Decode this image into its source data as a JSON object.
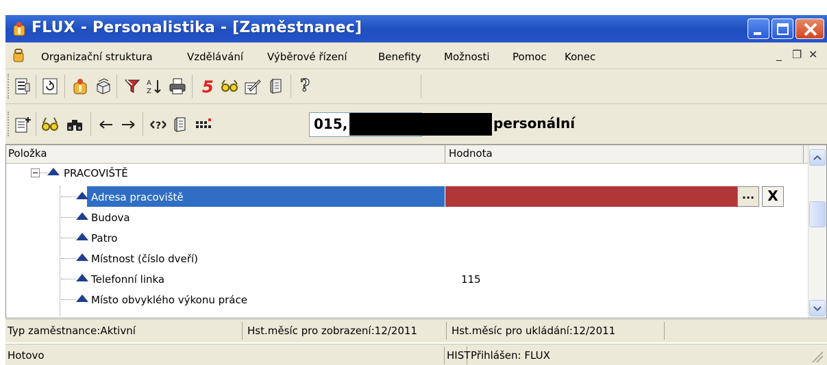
{
  "window": {
    "title": "FLUX - Personalistika - [Zaměstnanec]"
  },
  "menu": {
    "items": [
      "Organizační struktura",
      "Vzdělávání",
      "Výběrové řízení",
      "Benefity",
      "Možnosti",
      "Pomoc",
      "Konec"
    ]
  },
  "toolbar1": {
    "icons": [
      "form-icon",
      "refresh-icon",
      "organization-icon",
      "copy-records-icon",
      "filter-icon",
      "sort-az-icon",
      "print-icon",
      "number-five-icon",
      "glasses-icon",
      "edit-form-icon",
      "document-icon",
      "help-icon"
    ]
  },
  "toolbar2": {
    "record_id": "015,",
    "record_suffix": "personální"
  },
  "grid": {
    "columns": [
      "Položka",
      "Hodnota"
    ],
    "group": "PRACOVIŠTĚ",
    "rows": [
      {
        "label": "Adresa pracoviště",
        "value": "",
        "selected": true
      },
      {
        "label": "Budova",
        "value": ""
      },
      {
        "label": "Patro",
        "value": ""
      },
      {
        "label": "Místnost (číslo dveří)",
        "value": ""
      },
      {
        "label": "Telefonní linka",
        "value": "115"
      },
      {
        "label": "Místo obvyklého výkonu práce",
        "value": ""
      }
    ],
    "ellipsis": "...",
    "clear": "X"
  },
  "status": {
    "type": "Typ zaměstnance:Aktivní",
    "display_month": "Hst.měsíc pro zobrazení:12/2011",
    "save_month": "Hst.měsíc pro ukládání:12/2011",
    "state": "Hotovo",
    "hist": "HIST",
    "login": "Přihlášen: FLUX"
  },
  "colors": {
    "titlebar": "#2553c9",
    "selection": "#2f6ec4",
    "selected_value": "#b13638"
  }
}
